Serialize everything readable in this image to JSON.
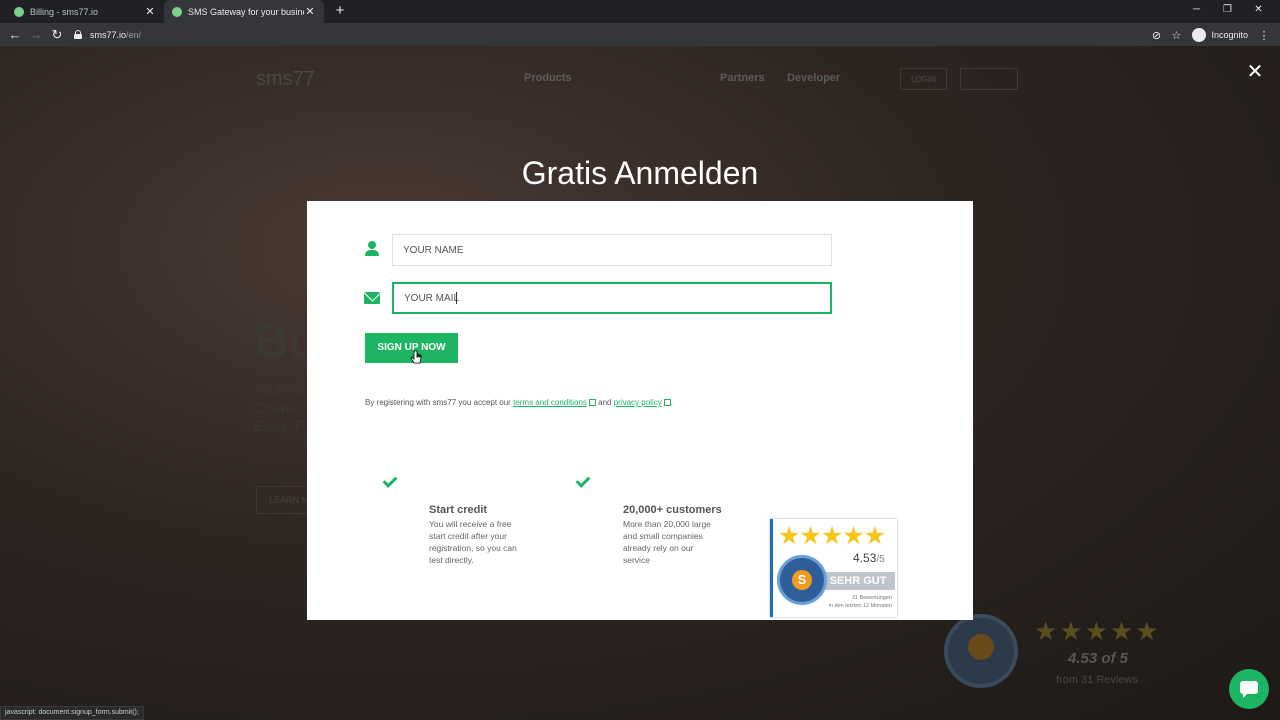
{
  "browser": {
    "tabs": [
      {
        "title": "Billing - sms77.io",
        "active": false
      },
      {
        "title": "SMS Gateway for your business",
        "active": true
      }
    ],
    "new_tab": "+",
    "url_host": "sms77.io",
    "url_path": "/en/",
    "incognito_label": "Incognito",
    "status_text": "javascript: document.signup_form.submit();"
  },
  "background_page": {
    "logo": "sms77",
    "nav_items": [
      "Products",
      "Partners",
      "Developer"
    ],
    "login": "LOGIN",
    "hero_title": "Bu",
    "hero_lines": [
      "Profess",
      "Online, ",
      "Easy. F"
    ],
    "learn_more": "LEARN M",
    "rating_score": "4.53 of 5",
    "rating_from": "from 31 Reviews"
  },
  "modal": {
    "title": "Gratis Anmelden",
    "name_placeholder": "YOUR NAME",
    "mail_value": "YOUR MAIL",
    "signup_label": "SIGN UP NOW",
    "legal_prefix": "By registering with sms77 you accept our ",
    "terms_label": "terms and conditions",
    "legal_and": " and ",
    "privacy_label": "privacy policy",
    "legal_suffix": ".",
    "features": [
      {
        "title": "Start credit",
        "description": "You will receive a free start credit after your registration, so you can test directly."
      },
      {
        "title": "20,000+ customers",
        "description": "More than 20,000 large and small companies already rely on our service"
      }
    ],
    "badge": {
      "stars": 5,
      "score": "4.53",
      "score_of": "/5",
      "grade": "SEHR GUT",
      "seal_letter": "S",
      "reviews_line1": "31 Bewertungen",
      "reviews_line2": "in den letzten 12 Monaten"
    }
  },
  "colors": {
    "accent": "#1db463",
    "modal_bg": "#ffffff",
    "badge_blue": "#1e6fb3"
  }
}
